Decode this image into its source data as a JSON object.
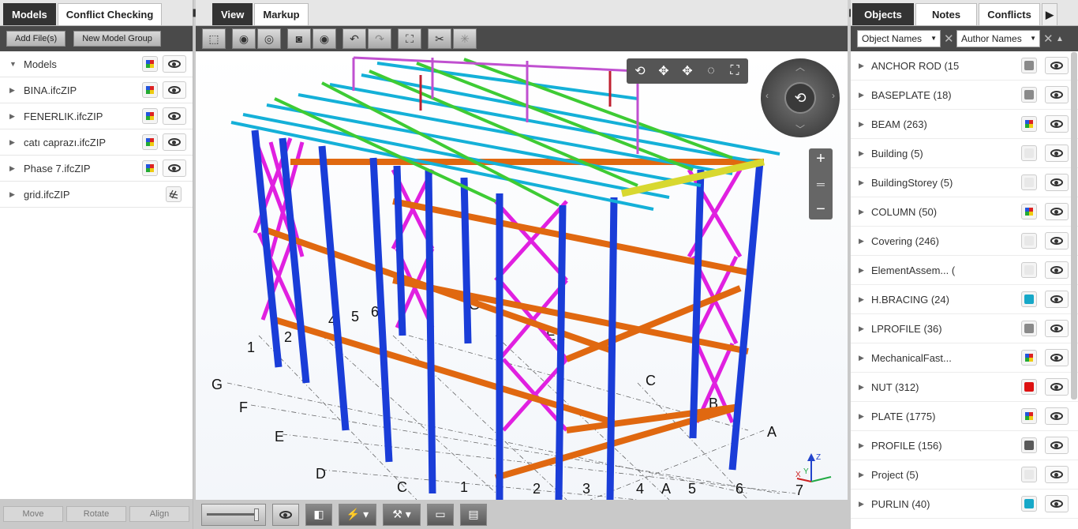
{
  "left_panel": {
    "tabs": [
      "Models",
      "Conflict Checking"
    ],
    "buttons": {
      "add_files": "Add File(s)",
      "new_model_group": "New Model Group"
    },
    "root": "Models",
    "models": [
      {
        "name": "BINA.ifcZIP",
        "chip": "multi"
      },
      {
        "name": "FENERLIK.ifcZIP",
        "chip": "multi"
      },
      {
        "name": "catı caprazı.ifcZIP",
        "chip": "multi"
      },
      {
        "name": "Phase 7.ifcZIP",
        "chip": "multi"
      },
      {
        "name": "grid.ifcZIP",
        "chip": "grid-icon"
      }
    ],
    "bottom_buttons": [
      "Move",
      "Rotate",
      "Align"
    ]
  },
  "center_panel": {
    "tabs": [
      "View",
      "Markup"
    ],
    "grid_labels": [
      "1",
      "2",
      "4",
      "5",
      "6",
      "G",
      "F",
      "E",
      "D",
      "C",
      "1",
      "2",
      "3",
      "4",
      "A",
      "5",
      "6",
      "7",
      "C",
      "B",
      "A",
      "G",
      "E"
    ]
  },
  "right_panel": {
    "tabs": [
      "Objects",
      "Notes",
      "Conflicts"
    ],
    "filters": {
      "left": "Object Names",
      "right": "Author Names"
    },
    "objects": [
      {
        "label": "ANCHOR ROD (15",
        "color": "#8a8a8a"
      },
      {
        "label": "BASEPLATE (18)",
        "color": "#8a8a8a"
      },
      {
        "label": "BEAM (263)",
        "color": "multi"
      },
      {
        "label": "Building (5)",
        "color": "#e8e8e8"
      },
      {
        "label": "BuildingStorey (5)",
        "color": "#e8e8e8"
      },
      {
        "label": "COLUMN (50)",
        "color": "multi"
      },
      {
        "label": "Covering (246)",
        "color": "#e8e8e8"
      },
      {
        "label": "ElementAssem... (",
        "color": "#e8e8e8"
      },
      {
        "label": "H.BRACING (24)",
        "color": "#17a8c8"
      },
      {
        "label": "LPROFILE (36)",
        "color": "#8a8a8a"
      },
      {
        "label": "MechanicalFast...",
        "color": "multi"
      },
      {
        "label": "NUT (312)",
        "color": "#dd1111"
      },
      {
        "label": "PLATE (1775)",
        "color": "multi"
      },
      {
        "label": "PROFILE (156)",
        "color": "#5a5a5a"
      },
      {
        "label": "Project (5)",
        "color": "#e8e8e8"
      },
      {
        "label": "PURLIN (40)",
        "color": "#17a8c8"
      }
    ]
  }
}
